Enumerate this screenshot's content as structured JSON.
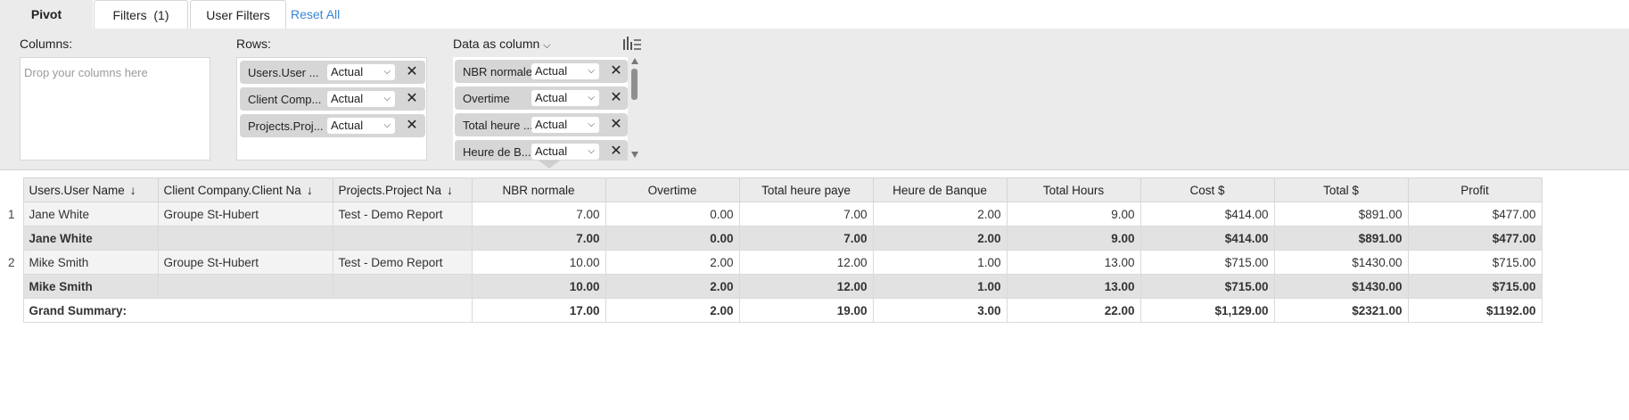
{
  "tabs": {
    "pivot": "Pivot",
    "filters": "Filters  (1)",
    "user_filters": "User Filters",
    "reset": "Reset All"
  },
  "config": {
    "columns_label": "Columns:",
    "columns_placeholder": "Drop your columns here",
    "rows_label": "Rows:",
    "rows": [
      {
        "label": "Users.User ...",
        "agg": "Actual"
      },
      {
        "label": "Client Comp...",
        "agg": "Actual"
      },
      {
        "label": "Projects.Proj...",
        "agg": "Actual"
      }
    ],
    "data_label": "Data as column",
    "data": [
      {
        "label": "NBR normale",
        "agg": "Actual"
      },
      {
        "label": "Overtime",
        "agg": "Actual"
      },
      {
        "label": "Total heure ...",
        "agg": "Actual"
      },
      {
        "label": "Heure de B...",
        "agg": "Actual"
      }
    ],
    "remove_glyph": "✕",
    "chart_icon": "chart-settings-icon"
  },
  "grid": {
    "row_headers": [
      "Users.User Name",
      "Client Company.Client Na",
      "Projects.Project Na"
    ],
    "sort_glyph": "↓",
    "columns": [
      "NBR normale",
      "Overtime",
      "Total heure paye",
      "Heure de Banque",
      "Total Hours",
      "Cost $",
      "Total $",
      "Profit"
    ],
    "rows": [
      {
        "num": "1",
        "user": "Jane White",
        "client": "Groupe St-Hubert",
        "project": "Test - Demo Report",
        "values": [
          "7.00",
          "0.00",
          "7.00",
          "2.00",
          "9.00",
          "$414.00",
          "$891.00",
          "$477.00"
        ]
      },
      {
        "subtotal": true,
        "user": "Jane White",
        "values": [
          "7.00",
          "0.00",
          "7.00",
          "2.00",
          "9.00",
          "$414.00",
          "$891.00",
          "$477.00"
        ]
      },
      {
        "num": "2",
        "user": "Mike Smith",
        "client": "Groupe St-Hubert",
        "project": "Test - Demo Report",
        "values": [
          "10.00",
          "2.00",
          "12.00",
          "1.00",
          "13.00",
          "$715.00",
          "$1430.00",
          "$715.00"
        ]
      },
      {
        "subtotal": true,
        "user": "Mike Smith",
        "values": [
          "10.00",
          "2.00",
          "12.00",
          "1.00",
          "13.00",
          "$715.00",
          "$1430.00",
          "$715.00"
        ]
      }
    ],
    "grand_label": "Grand Summary:",
    "grand_values": [
      "17.00",
      "2.00",
      "19.00",
      "3.00",
      "22.00",
      "$1,129.00",
      "$2321.00",
      "$1192.00"
    ]
  }
}
